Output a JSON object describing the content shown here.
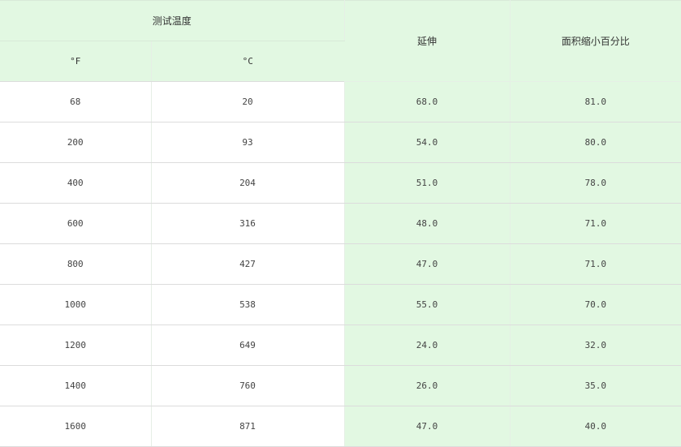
{
  "header": {
    "test_temp": "测试温度",
    "elongation": "延伸",
    "area_reduction": "面积缩小百分比",
    "unit_f": "°F",
    "unit_c": "°C"
  },
  "rows": [
    {
      "f": "68",
      "c": "20",
      "elong": "68.0",
      "area": "81.0"
    },
    {
      "f": "200",
      "c": "93",
      "elong": "54.0",
      "area": "80.0"
    },
    {
      "f": "400",
      "c": "204",
      "elong": "51.0",
      "area": "78.0"
    },
    {
      "f": "600",
      "c": "316",
      "elong": "48.0",
      "area": "71.0"
    },
    {
      "f": "800",
      "c": "427",
      "elong": "47.0",
      "area": "71.0"
    },
    {
      "f": "1000",
      "c": "538",
      "elong": "55.0",
      "area": "70.0"
    },
    {
      "f": "1200",
      "c": "649",
      "elong": "24.0",
      "area": "32.0"
    },
    {
      "f": "1400",
      "c": "760",
      "elong": "26.0",
      "area": "35.0"
    },
    {
      "f": "1600",
      "c": "871",
      "elong": "47.0",
      "area": "40.0"
    }
  ]
}
